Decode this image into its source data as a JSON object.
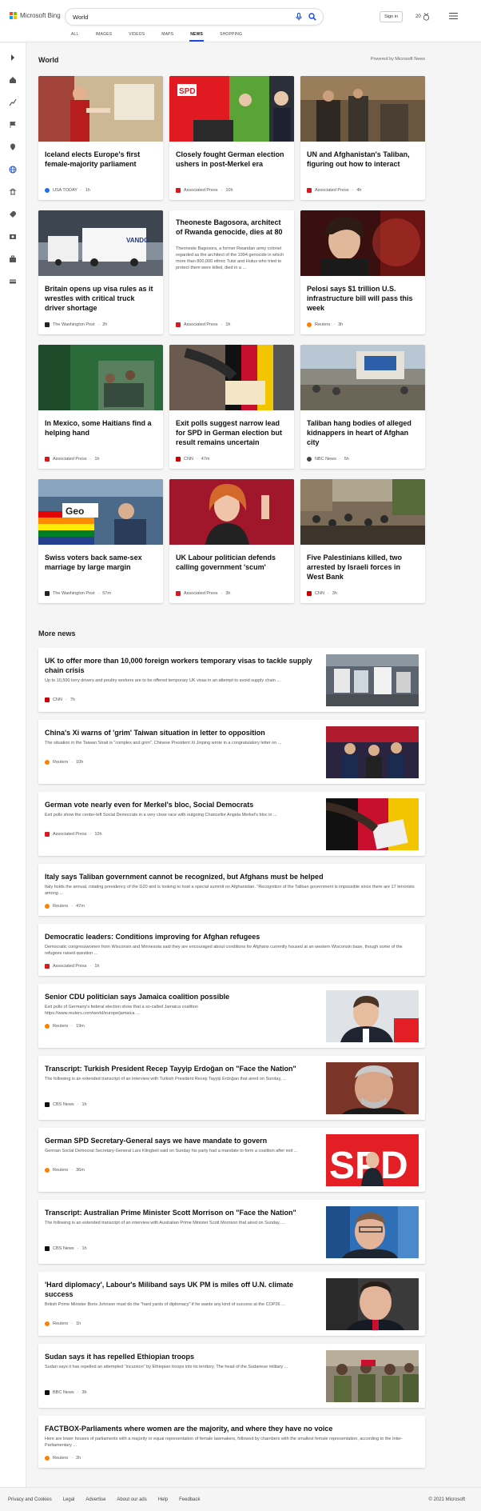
{
  "brand": {
    "name": "Microsoft Bing",
    "colors": [
      "#f25022",
      "#7fba00",
      "#00a4ef",
      "#ffb900"
    ]
  },
  "search": {
    "value": "World"
  },
  "header": {
    "signin": "Sign in",
    "points": "20"
  },
  "tabs": [
    {
      "label": "ALL"
    },
    {
      "label": "IMAGES"
    },
    {
      "label": "VIDEOS"
    },
    {
      "label": "MAPS"
    },
    {
      "label": "NEWS",
      "active": true
    },
    {
      "label": "SHOPPING"
    }
  ],
  "world": {
    "title": "World",
    "powered": "Powered by Microsoft News"
  },
  "cards": [
    {
      "title": "Iceland elects Europe's first female-majority parliament",
      "source": "USA TODAY",
      "age": "1h",
      "badge": "#1a73e8"
    },
    {
      "title": "Closely fought German election ushers in post-Merkel era",
      "source": "Associated Press",
      "age": "10h",
      "badge": "#d71920"
    },
    {
      "title": "UN and Afghanistan's Taliban, figuring out how to interact",
      "source": "Associated Press",
      "age": "4h",
      "badge": "#d71920"
    },
    {
      "title": "Britain opens up visa rules as it wrestles with critical truck driver shortage",
      "source": "The Washington Post",
      "age": "2h",
      "badge": "#222"
    },
    {
      "title": "Theoneste Bagosora, architect of Rwanda genocide, dies at 80",
      "desc": "Theoneste Bagosora, a former Rwandan army colonel regarded as the architect of the 1994 genocide in which more than 800,000 ethnic Tutsi and Hutus who tried to protect them were killed, died in a ...",
      "source": "Associated Press",
      "age": "1h",
      "badge": "#d71920"
    },
    {
      "title": "Pelosi says $1 trillion U.S. infrastructure bill will pass this week",
      "source": "Reuters",
      "age": "3h",
      "badge": "#ff8000"
    },
    {
      "title": "In Mexico, some Haitians find a helping hand",
      "source": "Associated Press",
      "age": "1h",
      "badge": "#d71920"
    },
    {
      "title": "Exit polls suggest narrow lead for SPD in German election but result remains uncertain",
      "source": "CNN",
      "age": "47m",
      "badge": "#cc0000"
    },
    {
      "title": "Taliban hang bodies of alleged kidnappers in heart of Afghan city",
      "source": "NBC News",
      "age": "5h",
      "badge": "#444"
    },
    {
      "title": "Swiss voters back same-sex marriage by large margin",
      "source": "The Washington Post",
      "age": "57m",
      "badge": "#222"
    },
    {
      "title": "UK Labour politician defends calling government 'scum'",
      "source": "Associated Press",
      "age": "3h",
      "badge": "#d71920"
    },
    {
      "title": "Five Palestinians killed, two arrested by Israeli forces in West Bank",
      "source": "CNN",
      "age": "3h",
      "badge": "#cc0000"
    }
  ],
  "more": {
    "title": "More news",
    "items": [
      {
        "title": "UK to offer more than 10,000 foreign workers temporary visas to tackle supply chain crisis",
        "snippet": "Up to 10,500 lorry drivers and poultry workers are to be offered temporary UK visas in an attempt to avoid supply chain ...",
        "source": "CNN",
        "age": "7h",
        "badge": "#cc0000"
      },
      {
        "title": "China's Xi warns of 'grim' Taiwan situation in letter to opposition",
        "snippet": "The situation in the Taiwan Strait is \"complex and grim\", Chinese President Xi Jinping wrote in a congratulatory letter on ...",
        "source": "Reuters",
        "age": "10h",
        "badge": "#ff8000"
      },
      {
        "title": "German vote nearly even for Merkel's bloc, Social Democrats",
        "snippet": "Exit polls show the center-left Social Democrats in a very close race with outgoing Chancellor Angela Merkel's bloc in ...",
        "source": "Associated Press",
        "age": "10h",
        "badge": "#d71920"
      },
      {
        "title": "Italy says Taliban government cannot be recognized, but Afghans must be helped",
        "snippet": "Italy holds the annual, rotating presidency of the G20 and is looking to host a special summit on Afghanistan. \"Recognition of the Taliban government is impossible since there are 17 terrorists among ...",
        "source": "Reuters",
        "age": "47m",
        "badge": "#ff8000"
      },
      {
        "title": "Democratic leaders: Conditions improving for Afghan refugees",
        "snippet": "Democratic congresswomen from Wisconsin and Minnesota said they are encouraged about conditions for Afghans currently housed at an western Wisconsin base, though some of the refugees raised question ...",
        "source": "Associated Press",
        "age": "1h",
        "badge": "#d71920"
      },
      {
        "title": "Senior CDU politician says Jamaica coalition possible",
        "snippet": "Exit polls of Germany's federal election show that a so-called Jamaica coalition https://www.reuters.com/world/europe/jamaica ...",
        "source": "Reuters",
        "age": "19m",
        "badge": "#ff8000"
      },
      {
        "title": "Transcript: Turkish President Recep Tayyip Erdoğan on \"Face the Nation\"",
        "snippet": "The following is an extended transcript of an interview with Turkish President Recep Tayyip Erdoğan that aired on Sunday, ...",
        "source": "CBS News",
        "age": "1h",
        "badge": "#111"
      },
      {
        "title": "German SPD Secretary-General says we have mandate to govern",
        "snippet": "German Social Democrat Secretary-General Lars Klingbeil said on Sunday his party had a mandate to form a coalition after exit ...",
        "source": "Reuters",
        "age": "36m",
        "badge": "#ff8000"
      },
      {
        "title": "Transcript: Australian Prime Minister Scott Morrison on \"Face the Nation\"",
        "snippet": "The following is an extended transcript of an interview with Australian Prime Minister Scott Morrison that aired on Sunday, ...",
        "source": "CBS News",
        "age": "1h",
        "badge": "#111"
      },
      {
        "title": "'Hard diplomacy', Labour's Miliband says UK PM is miles off U.N. climate success",
        "snippet": "British Prime Minister Boris Johnson must do the \"hard yards of diplomacy\" if he wants any kind of success at the COP26 ...",
        "source": "Reuters",
        "age": "1h",
        "badge": "#ff8000"
      },
      {
        "title": "Sudan says it has repelled Ethiopian troops",
        "snippet": "Sudan says it has repelled an attempted \"incursion\" by Ethiopian troops into its territory. The head of the Sudanese military ...",
        "source": "BBC News",
        "age": "3h",
        "badge": "#111"
      },
      {
        "title": "FACTBOX-Parliaments where women are the majority, and where they have no voice",
        "snippet": "Here are lower houses of parliaments with a majority or equal representation of female lawmakers, followed by chambers with the smallest female representation, according to the Inter-Parliamentary ...",
        "source": "Reuters",
        "age": "2h",
        "badge": "#ff8000"
      }
    ]
  },
  "footer": {
    "links": [
      "Privacy and Cookies",
      "Legal",
      "Advertise",
      "About our ads",
      "Help",
      "Feedback"
    ],
    "copyright": "© 2021 Microsoft"
  }
}
